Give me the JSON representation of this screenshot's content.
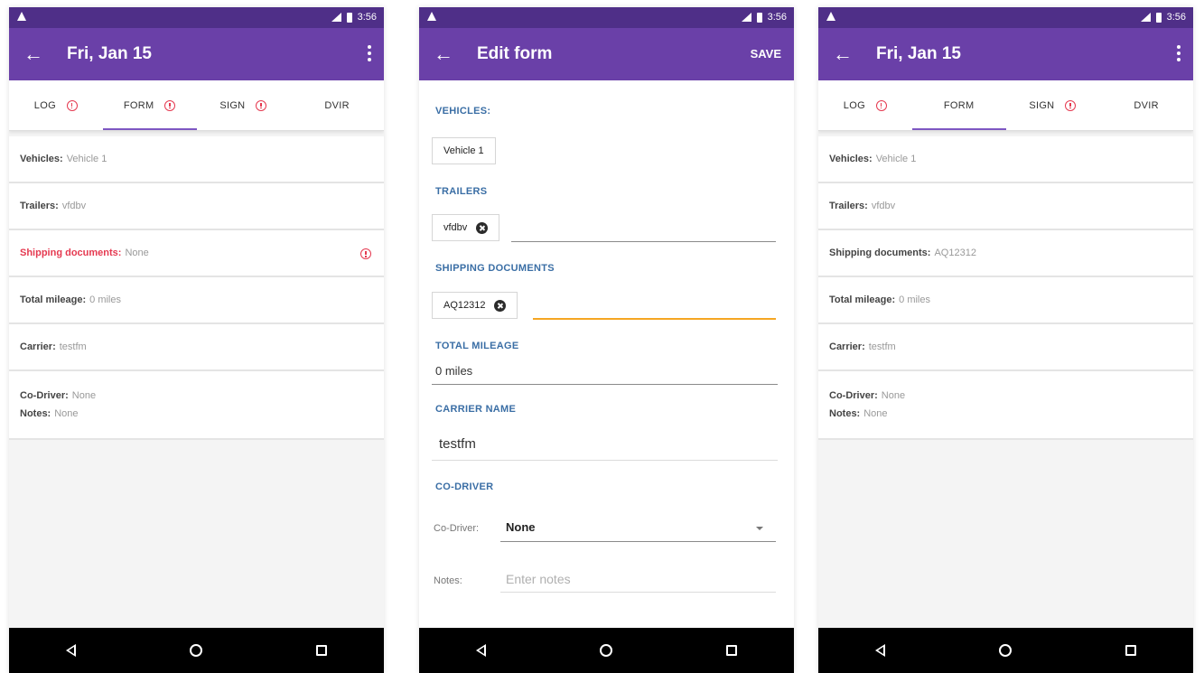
{
  "status": {
    "time": "3:56"
  },
  "screen1": {
    "title": "Fri, Jan 15",
    "tabs": [
      {
        "label": "LOG",
        "alert": true
      },
      {
        "label": "FORM",
        "alert": true,
        "active": true
      },
      {
        "label": "SIGN",
        "alert": true
      },
      {
        "label": "DVIR",
        "alert": false
      }
    ],
    "rows": {
      "vehicles": {
        "label": "Vehicles:",
        "value": "Vehicle 1"
      },
      "trailers": {
        "label": "Trailers:",
        "value": "vfdbv"
      },
      "shipping": {
        "label": "Shipping documents:",
        "value": "None"
      },
      "mileage": {
        "label": "Total mileage:",
        "value": "0 miles"
      },
      "carrier": {
        "label": "Carrier:",
        "value": "testfm"
      },
      "codriver": {
        "label": "Co-Driver:",
        "value": "None"
      },
      "notes": {
        "label": "Notes:",
        "value": "None"
      }
    }
  },
  "screen2": {
    "title": "Edit form",
    "save_label": "SAVE",
    "sections": {
      "vehicles": "VEHICLES:",
      "trailers": "TRAILERS",
      "shipping": "SHIPPING DOCUMENTS",
      "mileage": "TOTAL MILEAGE",
      "carrier": "CARRIER NAME",
      "codriver": "CO-DRIVER"
    },
    "vehicle_chip": "Vehicle 1",
    "trailer_chip": "vfdbv",
    "shipping_chip": "AQ12312",
    "mileage_value": "0 miles",
    "carrier_value": "testfm",
    "codriver_label": "Co-Driver:",
    "codriver_value": "None",
    "notes_label": "Notes:",
    "notes_placeholder": "Enter notes"
  },
  "screen3": {
    "title": "Fri, Jan 15",
    "tabs": [
      {
        "label": "LOG",
        "alert": true
      },
      {
        "label": "FORM",
        "alert": false,
        "active": true
      },
      {
        "label": "SIGN",
        "alert": true
      },
      {
        "label": "DVIR",
        "alert": false
      }
    ],
    "rows": {
      "vehicles": {
        "label": "Vehicles:",
        "value": "Vehicle 1"
      },
      "trailers": {
        "label": "Trailers:",
        "value": "vfdbv"
      },
      "shipping": {
        "label": "Shipping documents:",
        "value": "AQ12312"
      },
      "mileage": {
        "label": "Total mileage:",
        "value": "0 miles"
      },
      "carrier": {
        "label": "Carrier:",
        "value": "testfm"
      },
      "codriver": {
        "label": "Co-Driver:",
        "value": "None"
      },
      "notes": {
        "label": "Notes:",
        "value": "None"
      }
    }
  },
  "colors": {
    "status_bar": "#4f2f88",
    "app_bar": "#6a40a8",
    "alert": "#e53950",
    "section": "#3a6ea5",
    "focus": "#f5a623"
  }
}
